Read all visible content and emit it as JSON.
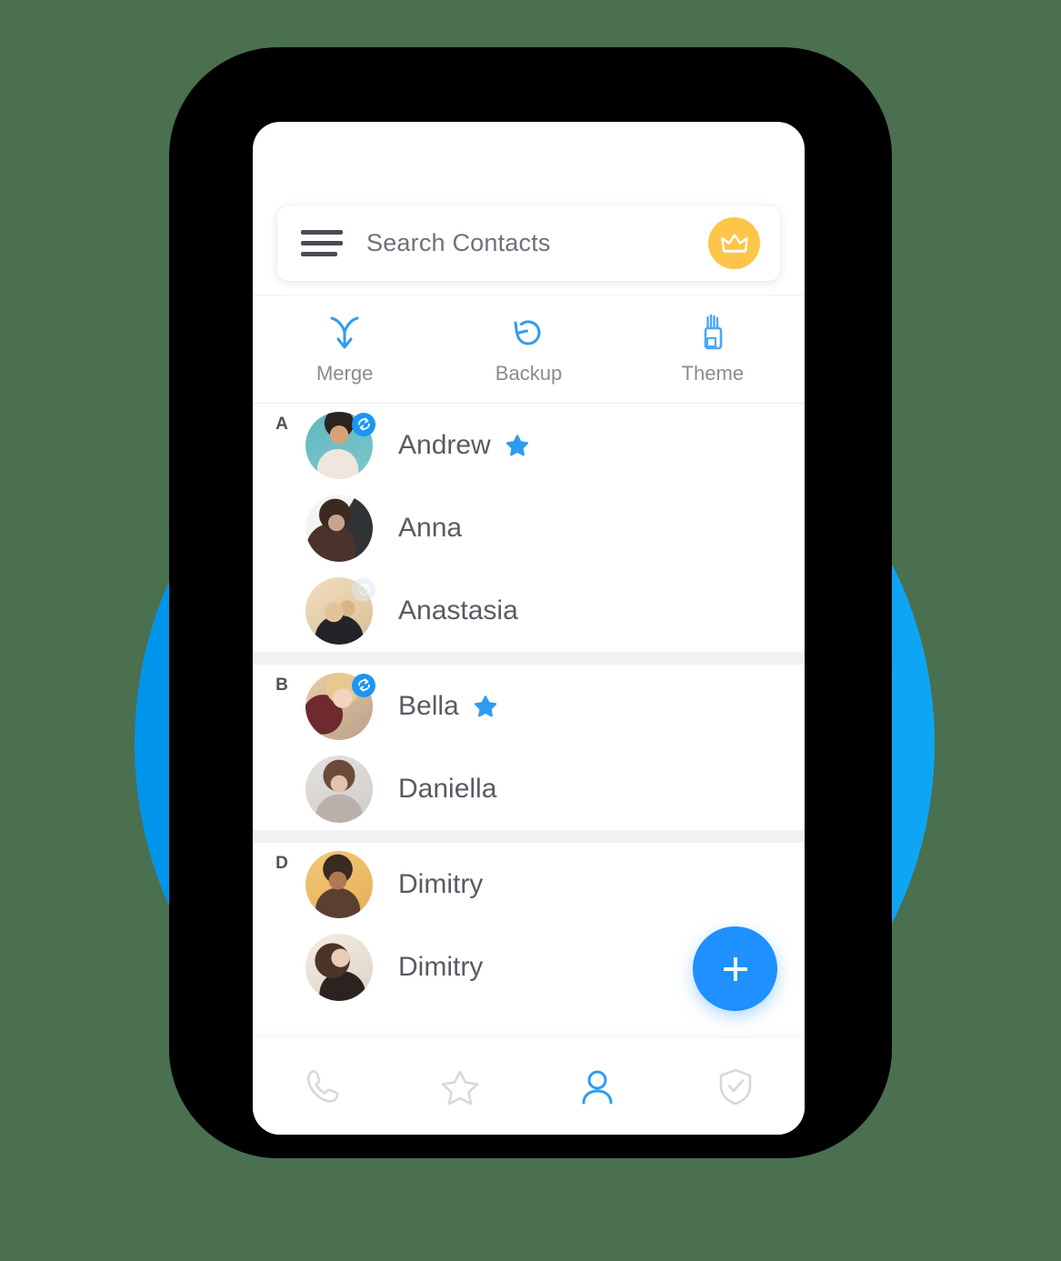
{
  "theme": {
    "page_background": "#4a704f",
    "accent_blue": "#1e90ff",
    "circle_blue_light": "#0ea6f4",
    "circle_blue_dark": "#00558c",
    "crown_yellow": "#fdc54a",
    "text_gray": "#5a5a63",
    "muted_gray": "#8b8b93"
  },
  "search": {
    "placeholder": "Search Contacts",
    "menu_icon": "hamburger-menu-icon",
    "premium_icon": "crown-icon"
  },
  "toolbar": {
    "items": [
      {
        "label": "Merge",
        "icon": "merge-arrow-icon"
      },
      {
        "label": "Backup",
        "icon": "restore-backup-icon"
      },
      {
        "label": "Theme",
        "icon": "paint-brushes-icon"
      }
    ]
  },
  "contacts": {
    "sections": [
      {
        "letter": "A",
        "rows": [
          {
            "name": "Andrew",
            "favorite": true,
            "sync": "on",
            "avatar": "photo-andrew"
          },
          {
            "name": "Anna",
            "favorite": false,
            "sync": "none",
            "avatar": "photo-anna"
          },
          {
            "name": "Anastasia",
            "favorite": false,
            "sync": "off",
            "avatar": "photo-anastasia"
          }
        ]
      },
      {
        "letter": "B",
        "rows": [
          {
            "name": "Bella",
            "favorite": true,
            "sync": "on",
            "avatar": "photo-bella"
          },
          {
            "name": "Daniella",
            "favorite": false,
            "sync": "none",
            "avatar": "photo-daniella"
          }
        ]
      },
      {
        "letter": "D",
        "rows": [
          {
            "name": "Dimitry",
            "favorite": false,
            "sync": "none",
            "avatar": "photo-dimitry-1"
          },
          {
            "name": "Dimitry",
            "favorite": false,
            "sync": "none",
            "avatar": "photo-dimitry-2"
          }
        ]
      }
    ]
  },
  "fab": {
    "icon": "plus-icon",
    "label": "+"
  },
  "bottom_nav": {
    "items": [
      {
        "icon": "phone-icon",
        "active": false
      },
      {
        "icon": "star-outline-icon",
        "active": false
      },
      {
        "icon": "person-icon",
        "active": true
      },
      {
        "icon": "shield-check-icon",
        "active": false
      }
    ]
  }
}
